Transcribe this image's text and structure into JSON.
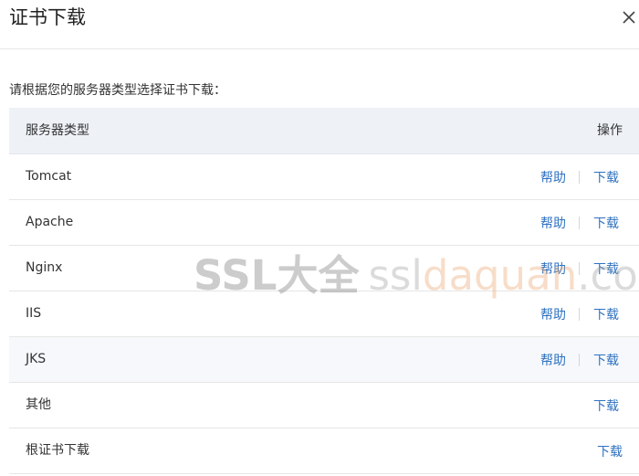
{
  "dialog": {
    "title": "证书下载"
  },
  "instruction": "请根据您的服务器类型选择证书下载：",
  "table": {
    "headers": {
      "type": "服务器类型",
      "action": "操作"
    },
    "rows": [
      {
        "type": "Tomcat",
        "help": "帮助",
        "download": "下载"
      },
      {
        "type": "Apache",
        "help": "帮助",
        "download": "下载"
      },
      {
        "type": "Nginx",
        "help": "帮助",
        "download": "下载"
      },
      {
        "type": "IIS",
        "help": "帮助",
        "download": "下载"
      },
      {
        "type": "JKS",
        "help": "帮助",
        "download": "下载"
      },
      {
        "type": "其他",
        "download": "下载"
      },
      {
        "type": "根证书下载",
        "download": "下载"
      }
    ]
  },
  "watermark": {
    "part1": "SSL大全",
    "part2": "ssl",
    "part3": "daquan",
    "part4": ".com"
  },
  "colors": {
    "link": "#2f72c0",
    "header_bg": "#eef2f7"
  },
  "icons": {
    "close": "close-icon"
  }
}
